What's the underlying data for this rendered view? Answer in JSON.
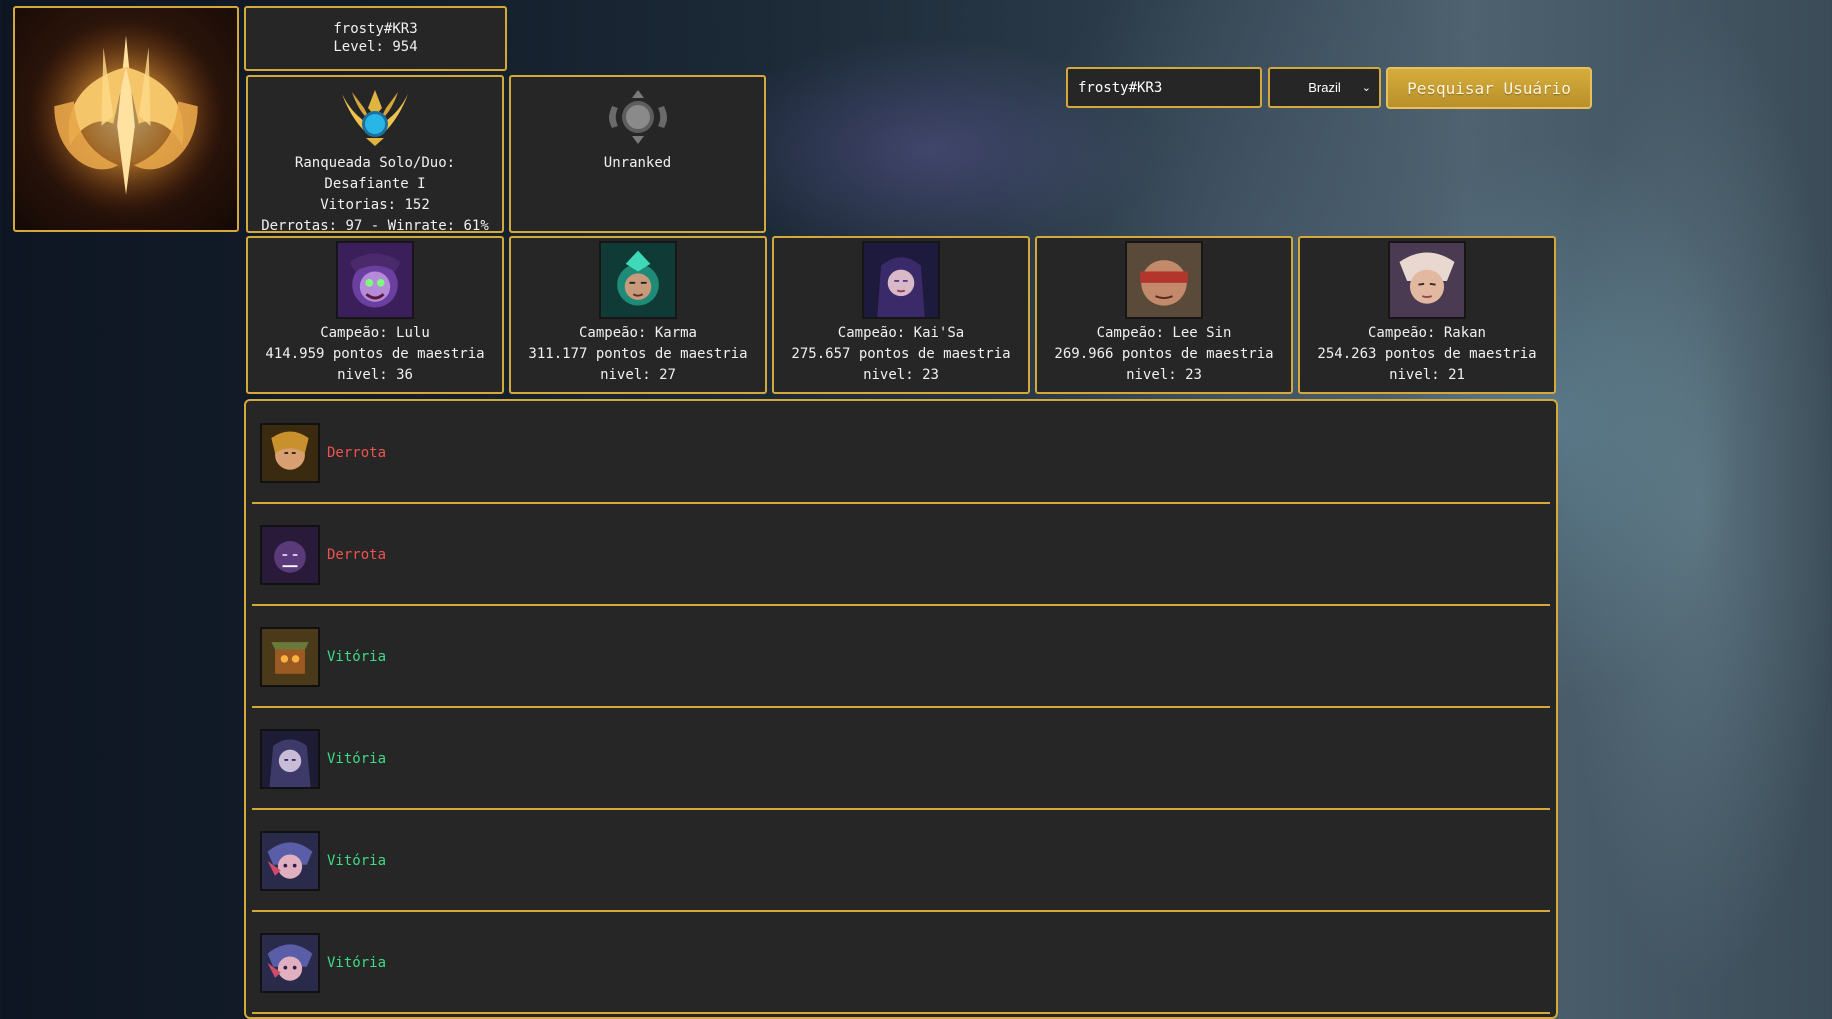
{
  "profile": {
    "riot_id": "frosty#KR3",
    "level_text": "Level: 954"
  },
  "ranked": {
    "solo": {
      "tier_line": "Ranqueada Solo/Duo: Desafiante I",
      "wins_line": "Vitorias: 152",
      "losses_line": "Derrotas: 97 - Winrate: 61%",
      "emblem_icon": "challenger-emblem-icon"
    },
    "flex": {
      "tier_line": "Unranked",
      "emblem_icon": "unranked-emblem-icon"
    }
  },
  "search": {
    "input_value": "frosty#KR3",
    "region_selected": "Brazil",
    "button_label": "Pesquisar Usuário"
  },
  "mastery": [
    {
      "champion_line": "Campeão: Lulu",
      "points_line": "414.959 pontos de maestria",
      "level_line": "nivel: 36",
      "portrait_color": "#6b3fa0"
    },
    {
      "champion_line": "Campeão: Karma",
      "points_line": "311.177 pontos de maestria",
      "level_line": "nivel: 27",
      "portrait_color": "#1f8a78"
    },
    {
      "champion_line": "Campeão: Kai'Sa",
      "points_line": "275.657 pontos de maestria",
      "level_line": "nivel: 23",
      "portrait_color": "#4a3a8a"
    },
    {
      "champion_line": "Campeão: Lee Sin",
      "points_line": "269.966 pontos de maestria",
      "level_line": "nivel: 23",
      "portrait_color": "#b3362c"
    },
    {
      "champion_line": "Campeão: Rakan",
      "points_line": "254.263 pontos de maestria",
      "level_line": "nivel: 21",
      "portrait_color": "#8a6a8e"
    }
  ],
  "matches": [
    {
      "result": "Derrota",
      "outcome": "loss",
      "champion_color": "#c9902e"
    },
    {
      "result": "Derrota",
      "outcome": "loss",
      "champion_color": "#5b3a7a"
    },
    {
      "result": "Vitória",
      "outcome": "win",
      "champion_color": "#9a5a22"
    },
    {
      "result": "Vitória",
      "outcome": "win",
      "champion_color": "#3d3a6a"
    },
    {
      "result": "Vitória",
      "outcome": "win",
      "champion_color": "#5a5ea8"
    },
    {
      "result": "Vitória",
      "outcome": "win",
      "champion_color": "#5a5ea8"
    }
  ],
  "colors": {
    "accent_gold": "#d4a93a",
    "panel_bg": "#262626",
    "win_green": "#3ddc84",
    "loss_red": "#ef5350"
  }
}
